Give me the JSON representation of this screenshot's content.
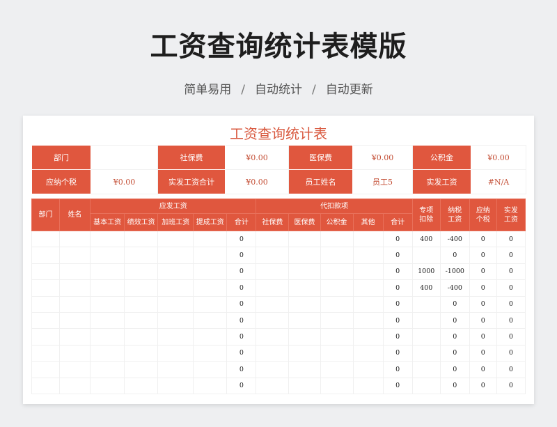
{
  "page": {
    "title": "工资查询统计表模版",
    "tags": [
      "简单易用",
      "自动统计",
      "自动更新"
    ],
    "separator": "/"
  },
  "sheet": {
    "title": "工资查询统计表",
    "info_rows": [
      [
        {
          "label": "部门",
          "value": ""
        },
        {
          "label": "社保费",
          "value": "¥0.00"
        },
        {
          "label": "医保费",
          "value": "¥0.00"
        },
        {
          "label": "公积金",
          "value": "¥0.00"
        }
      ],
      [
        {
          "label": "应纳个税",
          "value": "¥0.00"
        },
        {
          "label": "实发工资合计",
          "value": "¥0.00"
        },
        {
          "label": "员工姓名",
          "value": "员工5"
        },
        {
          "label": "实发工资",
          "value": "#N/A"
        }
      ]
    ],
    "headers": {
      "dept": "部门",
      "name": "姓名",
      "payable_group": "应发工资",
      "payable": [
        "基本工资",
        "绩效工资",
        "加班工资",
        "提成工资",
        "合计"
      ],
      "deduct_group": "代扣款项",
      "deduct": [
        "社保费",
        "医保费",
        "公积金",
        "其他",
        "合计"
      ],
      "special_line1": "专项",
      "special_line2": "扣除",
      "taxable_line1": "纳税",
      "taxable_line2": "工资",
      "tax_line1": "应纳",
      "tax_line2": "个税",
      "net_line1": "实发",
      "net_line2": "工资"
    },
    "rows": [
      {
        "payable_total": "0",
        "deduct_total": "0",
        "special": "400",
        "taxable": "-400",
        "tax": "0",
        "net": "0"
      },
      {
        "payable_total": "0",
        "deduct_total": "0",
        "special": "",
        "taxable": "0",
        "tax": "0",
        "net": "0"
      },
      {
        "payable_total": "0",
        "deduct_total": "0",
        "special": "1000",
        "taxable": "-1000",
        "tax": "0",
        "net": "0"
      },
      {
        "payable_total": "0",
        "deduct_total": "0",
        "special": "400",
        "taxable": "-400",
        "tax": "0",
        "net": "0"
      },
      {
        "payable_total": "0",
        "deduct_total": "0",
        "special": "",
        "taxable": "0",
        "tax": "0",
        "net": "0"
      },
      {
        "payable_total": "0",
        "deduct_total": "0",
        "special": "",
        "taxable": "0",
        "tax": "0",
        "net": "0"
      },
      {
        "payable_total": "0",
        "deduct_total": "0",
        "special": "",
        "taxable": "0",
        "tax": "0",
        "net": "0"
      },
      {
        "payable_total": "0",
        "deduct_total": "0",
        "special": "",
        "taxable": "0",
        "tax": "0",
        "net": "0"
      },
      {
        "payable_total": "0",
        "deduct_total": "0",
        "special": "",
        "taxable": "0",
        "tax": "0",
        "net": "0"
      },
      {
        "payable_total": "0",
        "deduct_total": "0",
        "special": "",
        "taxable": "0",
        "tax": "0",
        "net": "0"
      }
    ]
  },
  "colors": {
    "accent": "#e0573e",
    "title_red": "#d95a40",
    "background": "#eeeff1"
  }
}
